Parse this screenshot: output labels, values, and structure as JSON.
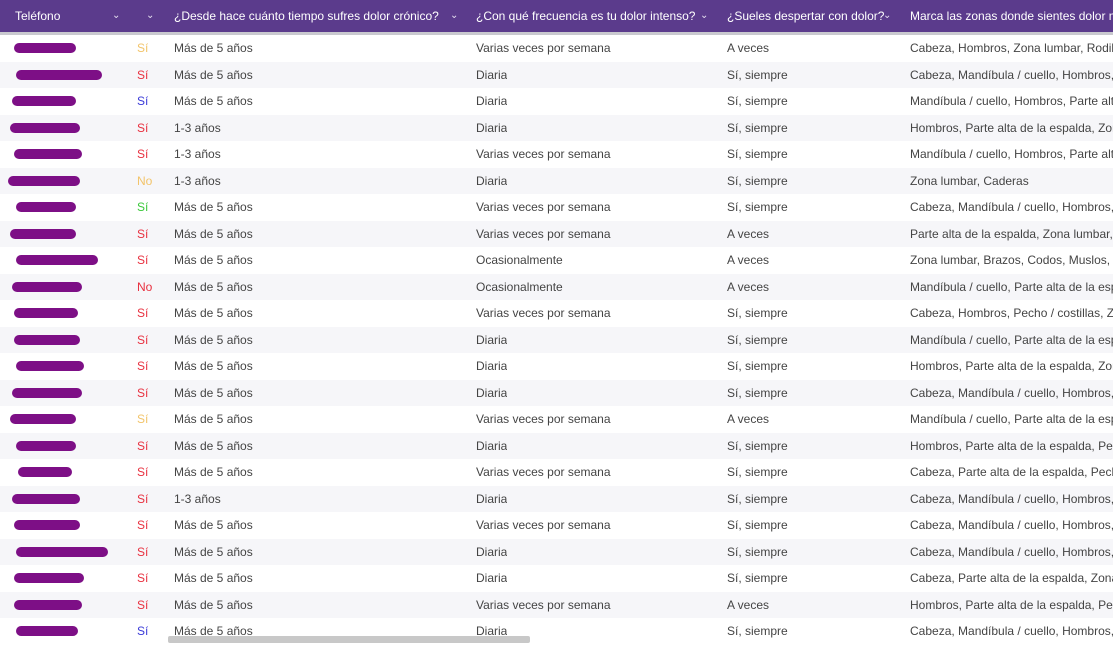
{
  "header": {
    "columns": [
      {
        "label": "Teléfono"
      },
      {
        "label": ""
      },
      {
        "label": "¿Desde hace cuánto tiempo sufres dolor crónico?"
      },
      {
        "label": "¿Con qué frecuencia es tu dolor intenso?"
      },
      {
        "label": "¿Sueles despertar con dolor?"
      },
      {
        "label": "Marca las zonas donde sientes dolor m"
      }
    ],
    "chevron": "⌄"
  },
  "colors": {
    "header": "#5b3b8c",
    "yellow": "#f2c46a",
    "red": "#e8303f",
    "blue": "#3a3ad8",
    "green": "#3ac83a",
    "orange": "#f0a020"
  },
  "rows": [
    {
      "flag": "Sí",
      "flag_color": "#f2c46a",
      "time": "Más de 5 años",
      "freq": "Varias veces por semana",
      "wake": "A veces",
      "zones": "Cabeza, Hombros, Zona lumbar, Rodilla"
    },
    {
      "flag": "Sí",
      "flag_color": "#e8303f",
      "time": "Más de 5 años",
      "freq": "Diaria",
      "wake": "Sí, siempre",
      "zones": "Cabeza, Mandíbula / cuello, Hombros, I"
    },
    {
      "flag": "Sí",
      "flag_color": "#3a3ad8",
      "time": "Más de 5 años",
      "freq": "Diaria",
      "wake": "Sí, siempre",
      "zones": "Mandíbula / cuello, Hombros, Parte alta"
    },
    {
      "flag": "Sí",
      "flag_color": "#e8303f",
      "time": "1-3 años",
      "freq": "Diaria",
      "wake": "Sí, siempre",
      "zones": "Hombros, Parte alta de la espalda, Zona"
    },
    {
      "flag": "Sí",
      "flag_color": "#e8303f",
      "time": "1-3 años",
      "freq": "Varias veces por semana",
      "wake": "Sí, siempre",
      "zones": "Mandíbula / cuello, Hombros, Parte alta"
    },
    {
      "flag": "No",
      "flag_color": "#f2c46a",
      "time": "1-3 años",
      "freq": "Diaria",
      "wake": "Sí, siempre",
      "zones": "Zona lumbar, Caderas"
    },
    {
      "flag": "Sí",
      "flag_color": "#3ac83a",
      "time": "Más de 5 años",
      "freq": "Varias veces por semana",
      "wake": "Sí, siempre",
      "zones": "Cabeza, Mandíbula / cuello, Hombros, C"
    },
    {
      "flag": "Sí",
      "flag_color": "#e8303f",
      "time": "Más de 5 años",
      "freq": "Varias veces por semana",
      "wake": "A veces",
      "zones": "Parte alta de la espalda, Zona lumbar, C"
    },
    {
      "flag": "Sí",
      "flag_color": "#e8303f",
      "time": "Más de 5 años",
      "freq": "Ocasionalmente",
      "wake": "A veces",
      "zones": "Zona lumbar, Brazos, Codos, Muslos, R"
    },
    {
      "flag": "No",
      "flag_color": "#e8303f",
      "time": "Más de 5 años",
      "freq": "Ocasionalmente",
      "wake": "A veces",
      "zones": "Mandíbula / cuello, Parte alta de la esp"
    },
    {
      "flag": "Sí",
      "flag_color": "#e8303f",
      "time": "Más de 5 años",
      "freq": "Varias veces por semana",
      "wake": "Sí, siempre",
      "zones": "Cabeza, Hombros, Pecho / costillas, Zo"
    },
    {
      "flag": "Sí",
      "flag_color": "#e8303f",
      "time": "Más de 5 años",
      "freq": "Diaria",
      "wake": "Sí, siempre",
      "zones": "Mandíbula / cuello, Parte alta de la esp"
    },
    {
      "flag": "Sí",
      "flag_color": "#e8303f",
      "time": "Más de 5 años",
      "freq": "Diaria",
      "wake": "Sí, siempre",
      "zones": "Hombros, Parte alta de la espalda, Zona"
    },
    {
      "flag": "Sí",
      "flag_color": "#e8303f",
      "time": "Más de 5 años",
      "freq": "Diaria",
      "wake": "Sí, siempre",
      "zones": "Cabeza, Mandíbula / cuello, Hombros, I"
    },
    {
      "flag": "Sí",
      "flag_color": "#f2c46a",
      "time": "Más de 5 años",
      "freq": "Varias veces por semana",
      "wake": "A veces",
      "zones": "Mandíbula / cuello, Parte alta de la esp"
    },
    {
      "flag": "Sí",
      "flag_color": "#e8303f",
      "time": "Más de 5 años",
      "freq": "Diaria",
      "wake": "Sí, siempre",
      "zones": "Hombros, Parte alta de la espalda, Pech"
    },
    {
      "flag": "Sí",
      "flag_color": "#e8303f",
      "time": "Más de 5 años",
      "freq": "Varias veces por semana",
      "wake": "Sí, siempre",
      "zones": "Cabeza, Parte alta de la espalda, Pecho"
    },
    {
      "flag": "Sí",
      "flag_color": "#e8303f",
      "time": "1-3 años",
      "freq": "Diaria",
      "wake": "Sí, siempre",
      "zones": "Cabeza, Mandíbula / cuello, Hombros, I"
    },
    {
      "flag": "Sí",
      "flag_color": "#e8303f",
      "time": "Más de 5 años",
      "freq": "Varias veces por semana",
      "wake": "Sí, siempre",
      "zones": "Cabeza, Mandíbula / cuello, Hombros, I"
    },
    {
      "flag": "Sí",
      "flag_color": "#e8303f",
      "time": "Más de 5 años",
      "freq": "Diaria",
      "wake": "Sí, siempre",
      "zones": "Cabeza, Mandíbula / cuello, Hombros, I"
    },
    {
      "flag": "Sí",
      "flag_color": "#e8303f",
      "time": "Más de 5 años",
      "freq": "Diaria",
      "wake": "Sí, siempre",
      "zones": "Cabeza, Parte alta de la espalda, Zona"
    },
    {
      "flag": "Sí",
      "flag_color": "#e8303f",
      "time": "Más de 5 años",
      "freq": "Varias veces por semana",
      "wake": "A veces",
      "zones": "Hombros, Parte alta de la espalda, Pech"
    },
    {
      "flag": "Sí",
      "flag_color": "#3a3ad8",
      "time": "Más de 5 años",
      "freq": "Diaria",
      "wake": "Sí, siempre",
      "zones": "Cabeza, Mandíbula / cuello, Hombros, I"
    }
  ]
}
